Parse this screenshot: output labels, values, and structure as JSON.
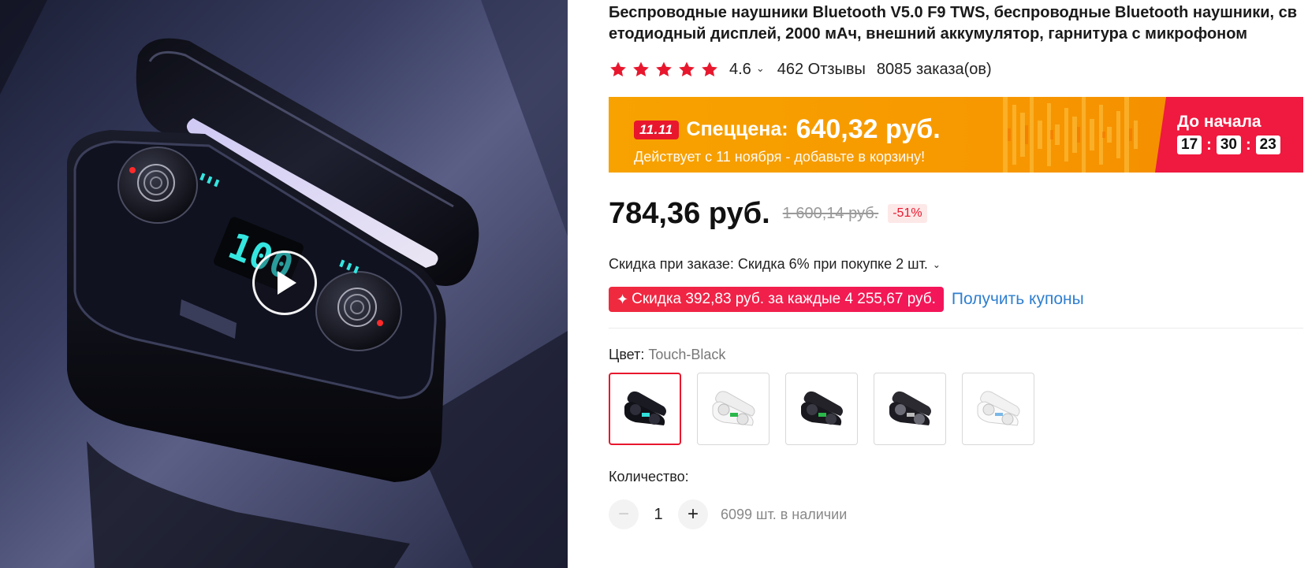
{
  "product": {
    "title": "Беспроводные наушники Bluetooth V5.0 F9 TWS, беспроводные Bluetooth наушники, светодиодный дисплей, 2000 мАч, внешний аккумулятор, гарнитура с микрофоном",
    "rating": "4.6",
    "rating_chevron": "⌄",
    "reviews": "462 Отзывы",
    "orders": "8085 заказа(ов)",
    "stars_filled": 5
  },
  "gallery": {
    "display_text": "100"
  },
  "promo": {
    "badge": "11.11",
    "label": "Спеццена:",
    "price": "640,32 руб.",
    "note": "Действует с 11 ноября - добавьте в корзину!",
    "countdown_title": "До начала",
    "hours": "17",
    "minutes": "30",
    "seconds": "23"
  },
  "pricing": {
    "price": "784,36 руб.",
    "old_price": "1 600,14 руб.",
    "discount": "-51%"
  },
  "order_discount": {
    "text": "Скидка при заказе: Скидка 6% при покупке 2 шт.",
    "chevron": "⌄"
  },
  "coupon": {
    "spark": "✦",
    "pill": "Скидка 392,83 руб. за каждые 4 255,67 руб.",
    "link": "Получить купоны"
  },
  "color": {
    "label": "Цвет: ",
    "selected": "Touch-Black",
    "options": [
      "black-touch",
      "white-display",
      "black-display",
      "black-classic",
      "white-classic"
    ]
  },
  "quantity": {
    "label": "Количество:",
    "minus": "−",
    "plus": "+",
    "value": "1",
    "stock": "6099 шт. в наличии"
  },
  "colors": {
    "accent_red": "#e8172d",
    "promo_orange": "#f7a200",
    "promo_pink": "#f0193f",
    "link_blue": "#2f7fcf"
  }
}
